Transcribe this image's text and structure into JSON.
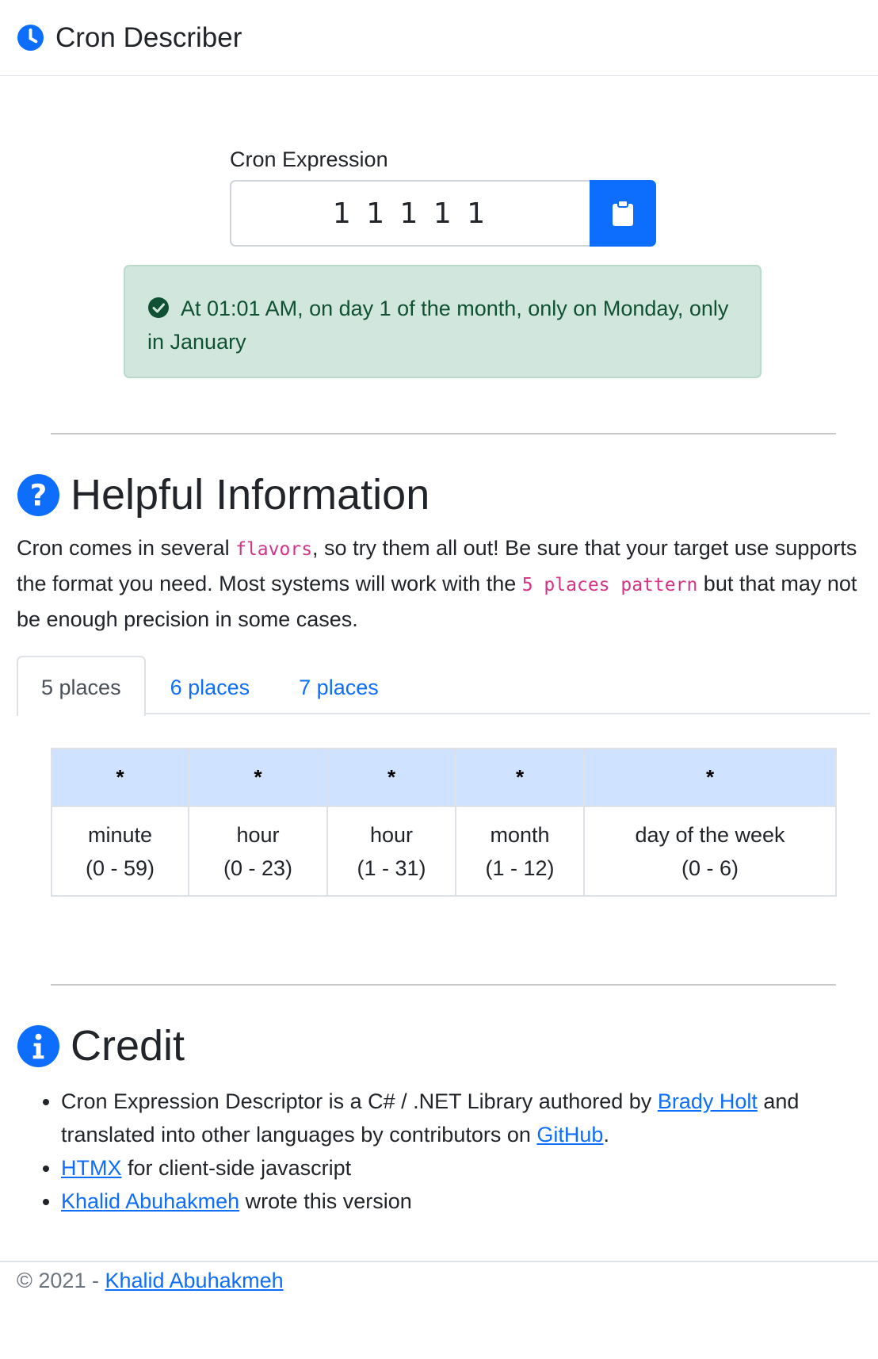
{
  "nav": {
    "brand": "Cron Describer",
    "brand_icon": "clock-icon"
  },
  "form": {
    "label": "Cron Expression",
    "value": "1 1 1 1 1",
    "copy_icon": "clipboard-icon"
  },
  "alert": {
    "icon": "check-circle-icon",
    "text": "At 01:01 AM, on day 1 of the month, only on Monday, only in January"
  },
  "help": {
    "icon": "question-circle-icon",
    "title": "Helpful Information",
    "text_1": "Cron comes in several ",
    "code_1": "flavors",
    "text_2": ", so try them all out! Be sure that your target use supports the format you need. Most systems will work with the ",
    "code_2": "5 places pattern",
    "text_3": " but that may not be enough precision in some cases."
  },
  "tabs": [
    {
      "label": "5 places",
      "active": true
    },
    {
      "label": "6 places",
      "active": false
    },
    {
      "label": "7 places",
      "active": false
    }
  ],
  "table": {
    "headers": [
      "*",
      "*",
      "*",
      "*",
      "*"
    ],
    "fields": [
      {
        "name": "minute",
        "range": "(0 - 59)"
      },
      {
        "name": "hour",
        "range": "(0 - 23)"
      },
      {
        "name": "hour",
        "range": "(1 - 31)"
      },
      {
        "name": "month",
        "range": "(1 - 12)"
      },
      {
        "name": "day of the week",
        "range": "(0 - 6)"
      }
    ]
  },
  "credit": {
    "icon": "info-circle-icon",
    "title": "Credit",
    "item1_text_a": "Cron Expression Descriptor is a C# / .NET Library authored by ",
    "item1_link_a": "Brady Holt",
    "item1_text_b": " and translated into other languages by contributors on ",
    "item1_link_b": "GitHub",
    "item1_text_c": ".",
    "item2_link": "HTMX",
    "item2_text": " for client-side javascript",
    "item3_link": "Khalid Abuhakmeh",
    "item3_text": " wrote this version"
  },
  "footer": {
    "text": "© 2021 - ",
    "link": "Khalid Abuhakmeh"
  },
  "colors": {
    "primary": "#0d6efd",
    "success_bg": "#d1e7dd",
    "success_text": "#0f5132",
    "table_header": "#cfe2ff"
  }
}
